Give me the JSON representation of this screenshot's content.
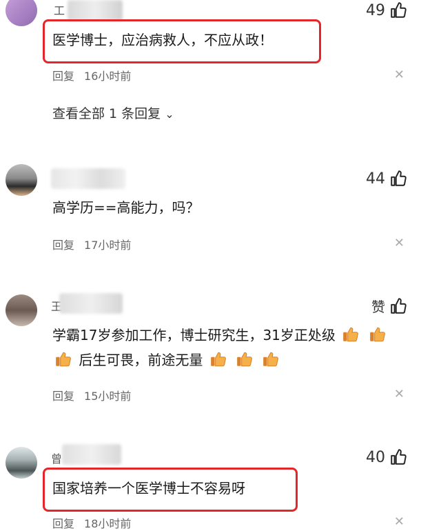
{
  "comments": [
    {
      "name_initial": "工",
      "likes": "49",
      "text": "医学博士，应治病救人，不应从政！",
      "reply_label": "回复",
      "time": "16小时前",
      "view_all": "查看全部 1 条回复"
    },
    {
      "name_initial": "",
      "likes": "44",
      "text": "高学历==高能力，吗？",
      "reply_label": "回复",
      "time": "17小时前"
    },
    {
      "name_initial": "王",
      "likes": "赞",
      "text_line1": "学霸17岁参加工作，博士研究生，31岁正处级",
      "text_line2_prefix": "后生可畏，前途无量",
      "reply_label": "回复",
      "time": "15小时前"
    },
    {
      "name_initial": "曾",
      "likes": "40",
      "text": "国家培养一个医学博士不容易呀",
      "reply_label": "回复",
      "time": "18小时前"
    }
  ],
  "icons": {
    "like": "thumbs-up-icon",
    "close": "close-icon",
    "chevron": "chevron-down-icon",
    "emoji": "thumbs-up-emoji"
  },
  "colors": {
    "highlight_border": "#e3262a",
    "emoji_thumb": "#f6a13a"
  }
}
